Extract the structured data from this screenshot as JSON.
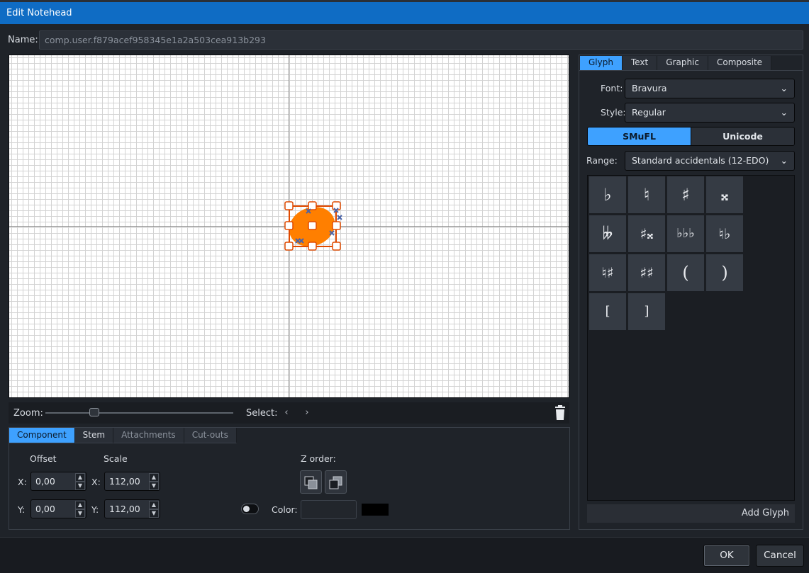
{
  "window": {
    "title": "Edit Notehead"
  },
  "name": {
    "label": "Name:",
    "value": "comp.user.f879acef958345e1a2a503cea913b293"
  },
  "canvas": {
    "glyph_color": "#ff7f00",
    "selection_color": "#e04a00"
  },
  "zoom": {
    "label": "Zoom:",
    "select_label": "Select:",
    "prev": "‹",
    "next": "›"
  },
  "component_tabs": [
    "Component",
    "Stem",
    "Attachments",
    "Cut-outs"
  ],
  "component": {
    "offset_label": "Offset",
    "scale_label": "Scale",
    "x_label": "X:",
    "y_label": "Y:",
    "offset_x": "0,00",
    "offset_y": "0,00",
    "scale_x": "112,00",
    "scale_y": "112,00",
    "zorder_label": "Z order:",
    "color_label": "Color:",
    "color_value": "#000000"
  },
  "right_tabs": [
    "Glyph",
    "Text",
    "Graphic",
    "Composite"
  ],
  "glyph": {
    "font_label": "Font:",
    "font_value": "Bravura",
    "style_label": "Style:",
    "style_value": "Regular",
    "smufl_label": "SMuFL",
    "unicode_label": "Unicode",
    "range_label": "Range:",
    "range_value": "Standard accidentals (12-EDO)",
    "cells": [
      "♭",
      "♮",
      "♯",
      "𝄪",
      "𝄫",
      "♯𝄪",
      "♭♭♭",
      "♮♭",
      "♮♯",
      "♯♯",
      "(",
      ")",
      "[",
      "]"
    ],
    "add_label": "Add Glyph"
  },
  "buttons": {
    "ok": "OK",
    "cancel": "Cancel"
  }
}
